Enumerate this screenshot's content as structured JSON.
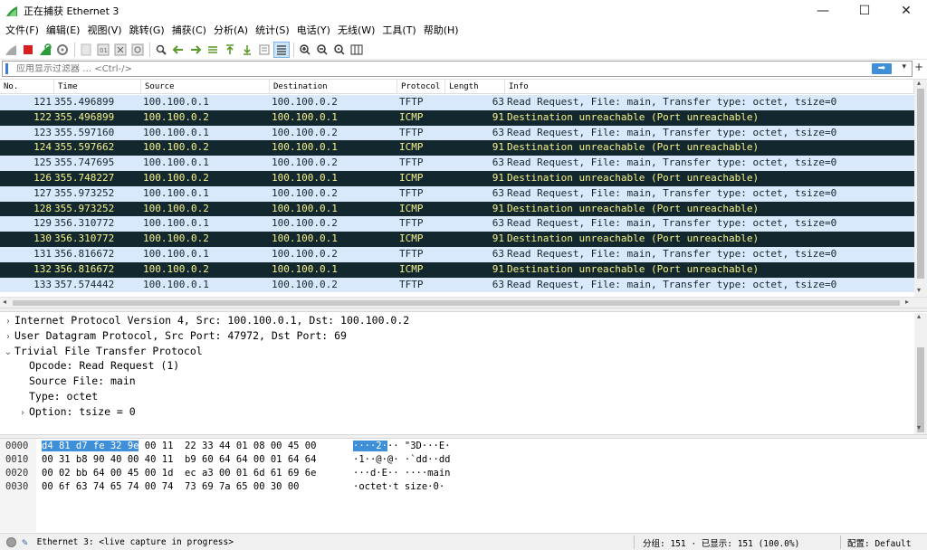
{
  "window": {
    "title": "正在捕获 Ethernet 3",
    "minimize": "—",
    "maximize": "☐",
    "close": "✕"
  },
  "menu": [
    "文件(F)",
    "编辑(E)",
    "视图(V)",
    "跳转(G)",
    "捕获(C)",
    "分析(A)",
    "统计(S)",
    "电话(Y)",
    "无线(W)",
    "工具(T)",
    "帮助(H)"
  ],
  "filter": {
    "placeholder": "应用显示过滤器 … <Ctrl-/>",
    "apply_icon": "arrow-right-icon"
  },
  "packet_list": {
    "columns": [
      "No.",
      "Time",
      "Source",
      "Destination",
      "Protocol",
      "Length",
      "Info"
    ],
    "rows": [
      {
        "no": "121",
        "time": "355.496899",
        "src": "100.100.0.1",
        "dst": "100.100.0.2",
        "proto": "TFTP",
        "len": "63",
        "info": "Read Request, File: main, Transfer type: octet, tsize=0"
      },
      {
        "no": "122",
        "time": "355.496899",
        "src": "100.100.0.2",
        "dst": "100.100.0.1",
        "proto": "ICMP",
        "len": "91",
        "info": "Destination unreachable (Port unreachable)"
      },
      {
        "no": "123",
        "time": "355.597160",
        "src": "100.100.0.1",
        "dst": "100.100.0.2",
        "proto": "TFTP",
        "len": "63",
        "info": "Read Request, File: main, Transfer type: octet, tsize=0"
      },
      {
        "no": "124",
        "time": "355.597662",
        "src": "100.100.0.2",
        "dst": "100.100.0.1",
        "proto": "ICMP",
        "len": "91",
        "info": "Destination unreachable (Port unreachable)"
      },
      {
        "no": "125",
        "time": "355.747695",
        "src": "100.100.0.1",
        "dst": "100.100.0.2",
        "proto": "TFTP",
        "len": "63",
        "info": "Read Request, File: main, Transfer type: octet, tsize=0"
      },
      {
        "no": "126",
        "time": "355.748227",
        "src": "100.100.0.2",
        "dst": "100.100.0.1",
        "proto": "ICMP",
        "len": "91",
        "info": "Destination unreachable (Port unreachable)"
      },
      {
        "no": "127",
        "time": "355.973252",
        "src": "100.100.0.1",
        "dst": "100.100.0.2",
        "proto": "TFTP",
        "len": "63",
        "info": "Read Request, File: main, Transfer type: octet, tsize=0"
      },
      {
        "no": "128",
        "time": "355.973252",
        "src": "100.100.0.2",
        "dst": "100.100.0.1",
        "proto": "ICMP",
        "len": "91",
        "info": "Destination unreachable (Port unreachable)"
      },
      {
        "no": "129",
        "time": "356.310772",
        "src": "100.100.0.1",
        "dst": "100.100.0.2",
        "proto": "TFTP",
        "len": "63",
        "info": "Read Request, File: main, Transfer type: octet, tsize=0"
      },
      {
        "no": "130",
        "time": "356.310772",
        "src": "100.100.0.2",
        "dst": "100.100.0.1",
        "proto": "ICMP",
        "len": "91",
        "info": "Destination unreachable (Port unreachable)"
      },
      {
        "no": "131",
        "time": "356.816672",
        "src": "100.100.0.1",
        "dst": "100.100.0.2",
        "proto": "TFTP",
        "len": "63",
        "info": "Read Request, File: main, Transfer type: octet, tsize=0"
      },
      {
        "no": "132",
        "time": "356.816672",
        "src": "100.100.0.2",
        "dst": "100.100.0.1",
        "proto": "ICMP",
        "len": "91",
        "info": "Destination unreachable (Port unreachable)"
      },
      {
        "no": "133",
        "time": "357.574442",
        "src": "100.100.0.1",
        "dst": "100.100.0.2",
        "proto": "TFTP",
        "len": "63",
        "info": "Read Request, File: main, Transfer type: octet, tsize=0"
      }
    ]
  },
  "details": [
    {
      "expander": "›",
      "text": "Internet Protocol Version 4, Src: 100.100.0.1, Dst: 100.100.0.2",
      "indent": 0
    },
    {
      "expander": "›",
      "text": "User Datagram Protocol, Src Port: 47972, Dst Port: 69",
      "indent": 0
    },
    {
      "expander": "⌄",
      "text": "Trivial File Transfer Protocol",
      "indent": 0
    },
    {
      "expander": "",
      "text": "Opcode: Read Request (1)",
      "indent": 1
    },
    {
      "expander": "",
      "text": "Source File: main",
      "indent": 1
    },
    {
      "expander": "",
      "text": "Type: octet",
      "indent": 1
    },
    {
      "expander": "›",
      "text": "Option: tsize = 0",
      "indent": 1
    }
  ],
  "bytes": [
    {
      "offset": "0000",
      "hex_hl": "d4 81 d7 fe 32 9e",
      "hex_rest": " 00 11  22 33 44 01 08 00 45 00",
      "ascii_hl": "····2·",
      "ascii_rest": "·· \"3D···E·"
    },
    {
      "offset": "0010",
      "hex_hl": "",
      "hex_rest": "00 31 b8 90 40 00 40 11  b9 60 64 64 00 01 64 64",
      "ascii_hl": "",
      "ascii_rest": "·1··@·@· ·`dd··dd"
    },
    {
      "offset": "0020",
      "hex_hl": "",
      "hex_rest": "00 02 bb 64 00 45 00 1d  ec a3 00 01 6d 61 69 6e",
      "ascii_hl": "",
      "ascii_rest": "···d·E·· ····main"
    },
    {
      "offset": "0030",
      "hex_hl": "",
      "hex_rest": "00 6f 63 74 65 74 00 74  73 69 7a 65 00 30 00",
      "ascii_hl": "",
      "ascii_rest": "·octet·t size·0·"
    }
  ],
  "status": {
    "capture": "Ethernet 3: <live capture in progress>",
    "counts": "分组: 151 · 已显示: 151 (100.0%)",
    "profile": "配置: Default"
  },
  "colors": {
    "tftp_bg": "#dae8fc",
    "icmp_bg": "#12272e",
    "icmp_fg": "#f7f28a",
    "highlight": "#3e8ed8"
  }
}
